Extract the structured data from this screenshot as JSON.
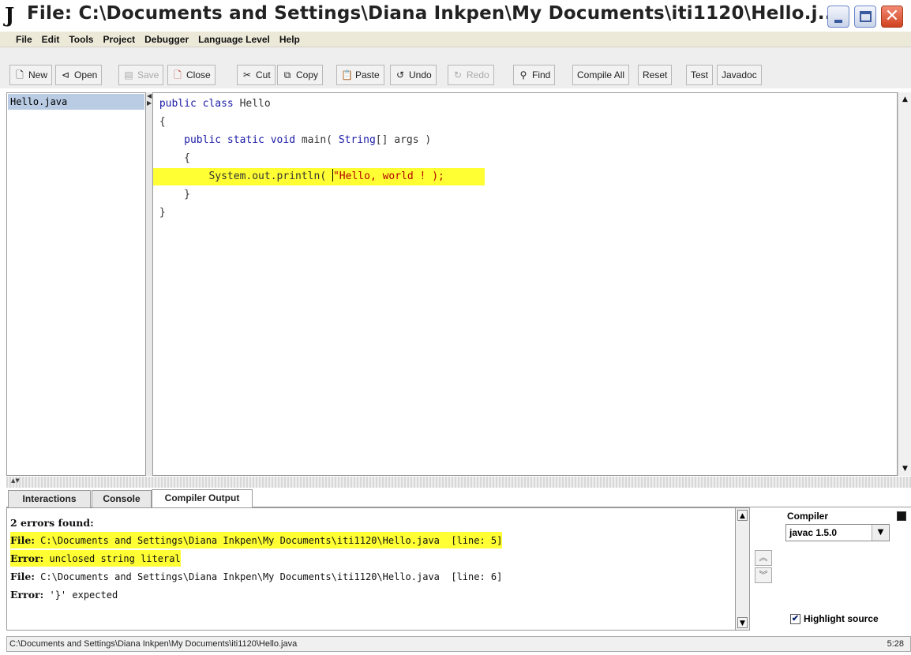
{
  "window": {
    "logo": "J",
    "title": "File: C:\\Documents and Settings\\Diana Inkpen\\My Documents\\iti1120\\Hello.j..."
  },
  "menu": [
    "File",
    "Edit",
    "Tools",
    "Project",
    "Debugger",
    "Language Level",
    "Help"
  ],
  "toolbar": {
    "new": "New",
    "open": "Open",
    "save": "Save",
    "close": "Close",
    "cut": "Cut",
    "copy": "Copy",
    "paste": "Paste",
    "undo": "Undo",
    "redo": "Redo",
    "find": "Find",
    "compile_all": "Compile All",
    "reset": "Reset",
    "test": "Test",
    "javadoc": "Javadoc"
  },
  "files": [
    "Hello.java"
  ],
  "code": {
    "l1_kw": "public class",
    "l1_rest": " Hello",
    "l2": "{",
    "l3_indent": "    ",
    "l3_kw": "public static void",
    "l3_mid": " main( ",
    "l3_type": "String",
    "l3_rest": "[] args )",
    "l4": "    {",
    "l5_pre": "        System.out.println( ",
    "l5_str": "\"Hello, world ! );",
    "l6": "    }",
    "l7": "}"
  },
  "tabs": [
    "Interactions",
    "Console",
    "Compiler Output"
  ],
  "output": {
    "summary": "2 errors found:",
    "file_label": "File:",
    "error_label": "Error:",
    "e1_path": " C:\\Documents and Settings\\Diana Inkpen\\My Documents\\iti1120\\Hello.java  [line: 5]",
    "e1_msg": " unclosed string literal",
    "e2_path": " C:\\Documents and Settings\\Diana Inkpen\\My Documents\\iti1120\\Hello.java  [line: 6]",
    "e2_msg": " '}' expected"
  },
  "compiler": {
    "label": "Compiler",
    "selected": "javac 1.5.0",
    "highlight_label": "Highlight source",
    "highlight_checked": true
  },
  "status": {
    "path": "C:\\Documents and Settings\\Diana Inkpen\\My Documents\\iti1120\\Hello.java",
    "position": "5:28"
  },
  "colors": {
    "highlight": "#ffff33",
    "keyword": "#1a1aa6",
    "string": "#b30000",
    "selected_file": "#b9cce4"
  }
}
